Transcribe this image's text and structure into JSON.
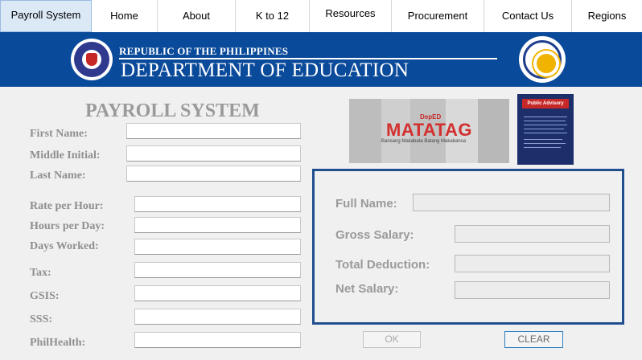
{
  "nav": {
    "tabs": [
      {
        "label": "Payroll System",
        "active": true
      },
      {
        "label": "Home"
      },
      {
        "label": "About"
      },
      {
        "label": "K to 12"
      },
      {
        "label": "Resources"
      },
      {
        "label": "Procurement"
      },
      {
        "label": "Contact Us"
      },
      {
        "label": "Regions"
      }
    ]
  },
  "banner": {
    "republic": "REPUBLIC OF THE PHILIPPINES",
    "department": "DEPARTMENT OF EDUCATION",
    "left_seal": "deped-seal-icon",
    "right_seal": "philippine-seal-icon"
  },
  "form": {
    "title": "PAYROLL SYSTEM",
    "fields": {
      "first_name": {
        "label": "First Name:",
        "value": ""
      },
      "middle_initial": {
        "label": "Middle Initial:",
        "value": ""
      },
      "last_name": {
        "label": "Last Name:",
        "value": ""
      },
      "rate_per_hour": {
        "label": "Rate per Hour:",
        "value": ""
      },
      "hours_per_day": {
        "label": "Hours per Day:",
        "value": ""
      },
      "days_worked": {
        "label": "Days Worked:",
        "value": ""
      },
      "tax": {
        "label": "Tax:",
        "value": ""
      },
      "gsis": {
        "label": "GSIS:",
        "value": ""
      },
      "sss": {
        "label": "SSS:",
        "value": ""
      },
      "philhealth": {
        "label": "PhilHealth:",
        "value": ""
      }
    }
  },
  "images": {
    "matatag": {
      "brand": "DepED",
      "word": "MATATAG",
      "tagline": "Bansang Makabata   Batang Makabansa"
    },
    "advisory": {
      "header": "Public Advisory"
    }
  },
  "results": {
    "full_name": {
      "label": "Full Name:",
      "value": ""
    },
    "gross_salary": {
      "label": "Gross Salary:",
      "value": ""
    },
    "total_deduction": {
      "label": "Total Deduction:",
      "value": ""
    },
    "net_salary": {
      "label": "Net Salary:",
      "value": ""
    }
  },
  "buttons": {
    "ok": "OK",
    "clear": "CLEAR"
  },
  "colors": {
    "banner": "#0a4a9a",
    "panel_border": "#1f4f8f",
    "active_tab": "#dbe9f7",
    "clear_border": "#2f7fc0"
  }
}
